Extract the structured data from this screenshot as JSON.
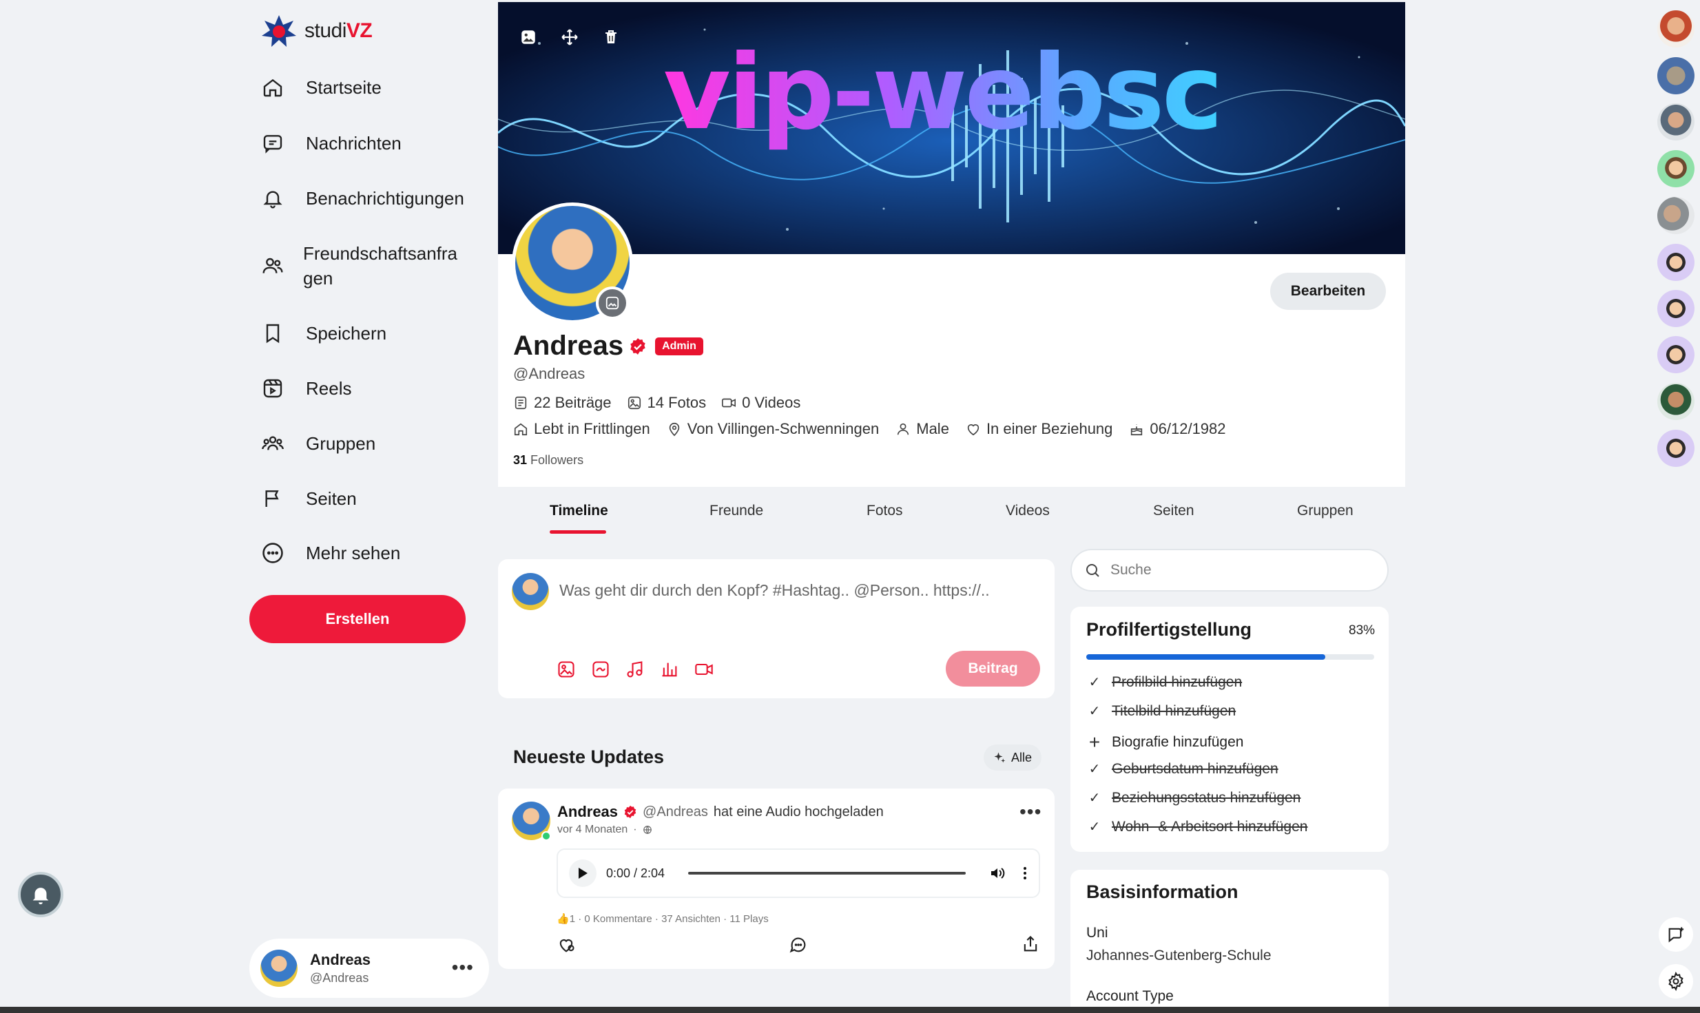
{
  "brand": {
    "name_prefix": "studi",
    "name_suffix": "VZ",
    "accent": "#e8132f"
  },
  "nav": {
    "items": [
      {
        "label": "Startseite",
        "icon": "home-icon"
      },
      {
        "label": "Nachrichten",
        "icon": "chat-icon"
      },
      {
        "label": "Benachrichtigungen",
        "icon": "bell-icon"
      },
      {
        "label": "Freundschaftsanfra\ngen",
        "icon": "friends-icon"
      },
      {
        "label": "Speichern",
        "icon": "bookmark-icon"
      },
      {
        "label": "Reels",
        "icon": "reels-icon"
      },
      {
        "label": "Gruppen",
        "icon": "groups-icon"
      },
      {
        "label": "Seiten",
        "icon": "flag-icon"
      },
      {
        "label": "Mehr sehen",
        "icon": "more-circle-icon"
      }
    ],
    "create_label": "Erstellen"
  },
  "current_user": {
    "name": "Andreas",
    "handle": "@Andreas"
  },
  "cover": {
    "title_text": "vip-websc"
  },
  "profile": {
    "name": "Andreas",
    "badge": "Admin",
    "handle": "@Andreas",
    "edit_label": "Bearbeiten",
    "stats": {
      "posts": "22 Beiträge",
      "photos": "14 Fotos",
      "videos": "0 Videos"
    },
    "info": {
      "lives": "Lebt in Frittlingen",
      "from": "Von Villingen-Schwenningen",
      "gender": "Male",
      "relationship": "In einer Beziehung",
      "birthday": "06/12/1982"
    },
    "followers_count": "31",
    "followers_label": "Followers"
  },
  "tabs": [
    "Timeline",
    "Freunde",
    "Fotos",
    "Videos",
    "Seiten",
    "Gruppen"
  ],
  "active_tab": "Timeline",
  "composer": {
    "placeholder": "Was geht dir durch den Kopf? #Hashtag.. @Person.. https://..",
    "post_label": "Beitrag"
  },
  "updates": {
    "title": "Neueste Updates",
    "filter_label": "Alle"
  },
  "post": {
    "author": "Andreas",
    "handle": "@Andreas",
    "action": "hat eine Audio hochgeladen",
    "time": "vor 4 Monaten",
    "audio_time": "0:00 / 2:04",
    "meta": "1 · 0 Kommentare · 37 Ansichten · 11 Plays"
  },
  "search": {
    "placeholder": "Suche"
  },
  "profile_completion": {
    "title": "Profilfertigstellung",
    "percent_label": "83%",
    "percent": 83,
    "items": [
      {
        "label": "Profilbild hinzufügen",
        "done": true
      },
      {
        "label": "Titelbild hinzufügen",
        "done": true
      },
      {
        "label": "Biografie hinzufügen",
        "done": false
      },
      {
        "label": "Geburtsdatum hinzufügen",
        "done": true
      },
      {
        "label": "Beziehungsstatus hinzufügen",
        "done": true
      },
      {
        "label": "Wohn- & Arbeitsort hinzufügen",
        "done": true
      }
    ]
  },
  "basic_info": {
    "title": "Basisinformation",
    "uni_label": "Uni",
    "uni_value": "Johannes-Gutenberg-Schule",
    "account_type_label": "Account Type"
  },
  "colors": {
    "primary": "#e8132f",
    "progress": "#1666d8",
    "background": "#f0f2f5"
  }
}
